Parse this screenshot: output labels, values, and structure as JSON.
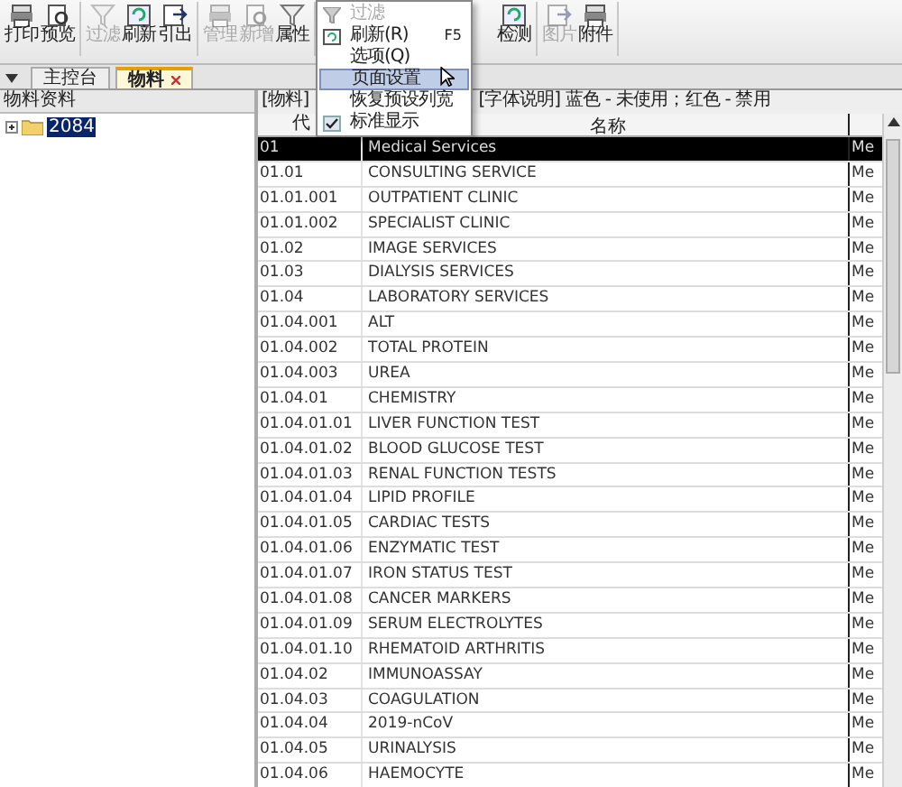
{
  "toolbar": {
    "groups": [
      [
        {
          "label": "打印",
          "disabled": false
        },
        {
          "label": "预览",
          "disabled": false
        }
      ],
      [
        {
          "label": "过滤",
          "disabled": true
        },
        {
          "label": "刷新",
          "disabled": false
        },
        {
          "label": "引出",
          "disabled": false
        }
      ],
      [
        {
          "label": "管理",
          "disabled": true
        },
        {
          "label": "新增",
          "disabled": true
        },
        {
          "label": "属性",
          "disabled": false
        }
      ],
      [
        {
          "label": "检测",
          "disabled": false
        }
      ],
      [
        {
          "label": "图片",
          "disabled": true
        },
        {
          "label": "附件",
          "disabled": false
        }
      ]
    ]
  },
  "tabs": [
    {
      "label": "主控台",
      "selected": false,
      "closable": false
    },
    {
      "label": "物料",
      "selected": true,
      "closable": true
    }
  ],
  "tree": {
    "title": "物料资料",
    "items": [
      {
        "label": "2084",
        "selected": true,
        "expanded": false
      }
    ]
  },
  "info": {
    "prefix": "[物料]",
    "legend": "[字体说明] 蓝色 - 未使用；红色 - 禁用"
  },
  "table": {
    "columns": [
      "代",
      "名称"
    ],
    "rows": [
      {
        "code": "01",
        "name": "Medical Services",
        "column_3": "Me",
        "selected": true
      },
      {
        "code": "01.01",
        "name": "CONSULTING SERVICE",
        "column_3": "Me",
        "selected": false
      },
      {
        "code": "01.01.001",
        "name": "OUTPATIENT CLINIC",
        "column_3": "Me",
        "selected": false
      },
      {
        "code": "01.01.002",
        "name": "SPECIALIST CLINIC",
        "column_3": "Me",
        "selected": false
      },
      {
        "code": "01.02",
        "name": "IMAGE SERVICES",
        "column_3": "Me",
        "selected": false
      },
      {
        "code": "01.03",
        "name": "DIALYSIS SERVICES",
        "column_3": "Me",
        "selected": false
      },
      {
        "code": "01.04",
        "name": "LABORATORY SERVICES",
        "column_3": "Me",
        "selected": false
      },
      {
        "code": "01.04.001",
        "name": "ALT",
        "column_3": "Me",
        "selected": false
      },
      {
        "code": "01.04.002",
        "name": "TOTAL PROTEIN",
        "column_3": "Me",
        "selected": false
      },
      {
        "code": "01.04.003",
        "name": "UREA",
        "column_3": "Me",
        "selected": false
      },
      {
        "code": "01.04.01",
        "name": "CHEMISTRY",
        "column_3": "Me",
        "selected": false
      },
      {
        "code": "01.04.01.01",
        "name": "LIVER FUNCTION TEST",
        "column_3": "Me",
        "selected": false
      },
      {
        "code": "01.04.01.02",
        "name": "BLOOD GLUCOSE TEST",
        "column_3": "Me",
        "selected": false
      },
      {
        "code": "01.04.01.03",
        "name": "RENAL FUNCTION TESTS",
        "column_3": "Me",
        "selected": false
      },
      {
        "code": "01.04.01.04",
        "name": "LIPID PROFILE",
        "column_3": "Me",
        "selected": false
      },
      {
        "code": "01.04.01.05",
        "name": "CARDIAC TESTS",
        "column_3": "Me",
        "selected": false
      },
      {
        "code": "01.04.01.06",
        "name": "ENZYMATIC TEST",
        "column_3": "Me",
        "selected": false
      },
      {
        "code": "01.04.01.07",
        "name": "IRON STATUS TEST",
        "column_3": "Me",
        "selected": false
      },
      {
        "code": "01.04.01.08",
        "name": "CANCER MARKERS",
        "column_3": "Me",
        "selected": false
      },
      {
        "code": "01.04.01.09",
        "name": "SERUM ELECTROLYTES",
        "column_3": "Me",
        "selected": false
      },
      {
        "code": "01.04.01.10",
        "name": "RHEMATOID ARTHRITIS",
        "column_3": "Me",
        "selected": false
      },
      {
        "code": "01.04.02",
        "name": "IMMUNOASSAY",
        "column_3": "Me",
        "selected": false
      },
      {
        "code": "01.04.03",
        "name": "COAGULATION",
        "column_3": "Me",
        "selected": false
      },
      {
        "code": "01.04.04",
        "name": "2019-nCoV",
        "column_3": "Me",
        "selected": false
      },
      {
        "code": "01.04.05",
        "name": "URINALYSIS",
        "column_3": "Me",
        "selected": false
      },
      {
        "code": "01.04.06",
        "name": "HAEMOCYTE",
        "column_3": "Me",
        "selected": false
      }
    ]
  },
  "context_menu": {
    "items": [
      {
        "label": "过滤",
        "disabled": true,
        "selected": false,
        "checked": false,
        "kind": "funnel"
      },
      {
        "label": "刷新(R)",
        "shortcut": "F5",
        "disabled": false,
        "selected": false,
        "checked": false,
        "kind": "refresh"
      },
      {
        "label": "选项(Q)",
        "disabled": false,
        "selected": false,
        "checked": false,
        "kind": "plain"
      },
      {
        "label": "页面设置",
        "disabled": false,
        "selected": true,
        "checked": false,
        "kind": "plain"
      },
      {
        "label": "恢复预设列宽",
        "disabled": false,
        "selected": false,
        "checked": false,
        "kind": "plain"
      },
      {
        "label": "标准显示",
        "disabled": false,
        "selected": false,
        "checked": true,
        "kind": "plain"
      }
    ]
  }
}
